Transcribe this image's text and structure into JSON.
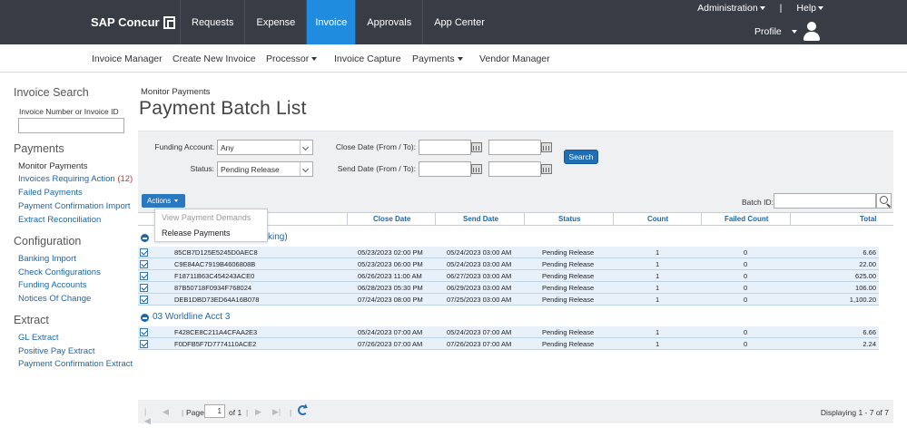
{
  "header": {
    "logo": "SAP Concur",
    "tabs": [
      "Requests",
      "Expense",
      "Invoice",
      "Approvals",
      "App Center"
    ],
    "active_tab": "Invoice",
    "administration": "Administration",
    "separator": "|",
    "help": "Help",
    "profile": "Profile"
  },
  "subnav": {
    "items": [
      "Invoice Manager",
      "Create New Invoice",
      "Processor",
      "Invoice Capture",
      "Payments",
      "Vendor Manager"
    ]
  },
  "sidebar": {
    "invoice_search_title": "Invoice Search",
    "invoice_number_label": "Invoice Number or Invoice ID",
    "payments_title": "Payments",
    "payments_items": [
      "Monitor Payments",
      "Invoices Requiring Action",
      "Failed Payments",
      "Payment Confirmation Import",
      "Extract Reconciliation"
    ],
    "requiring_action_count": "(12)",
    "configuration_title": "Configuration",
    "configuration_items": [
      "Banking Import",
      "Check Configurations",
      "Funding Accounts",
      "Notices Of Change"
    ],
    "extract_title": "Extract",
    "extract_items": [
      "GL Extract",
      "Positive Pay Extract",
      "Payment Confirmation Extract"
    ]
  },
  "main": {
    "breadcrumb": "Monitor Payments",
    "title": "Payment Batch List",
    "filters": {
      "funding_account_label": "Funding Account:",
      "funding_account_value": "Any",
      "status_label": "Status:",
      "status_value": "Pending Release",
      "close_date_label": "Close Date (From / To):",
      "send_date_label": "Send Date (From / To):",
      "search_button": "Search"
    },
    "toolbar": {
      "actions_button": "Actions",
      "batch_id_label": "Batch ID:"
    },
    "actions_menu": [
      "View Payment Demands",
      "Release Payments"
    ],
    "columns": [
      "Close Date",
      "Send Date",
      "Status",
      "Count",
      "Failed Count",
      "Total"
    ],
    "groups": [
      {
        "name_visible": "cking)",
        "rows": [
          {
            "id": "85CB7D125E5245D0AEC8",
            "close": "05/23/2023 02:00 PM",
            "send": "05/24/2023 03:00 AM",
            "status": "Pending Release",
            "count": "1",
            "failed": "0",
            "total": "6.66"
          },
          {
            "id": "C9E84AC7919B4606808B",
            "close": "05/23/2023 06:00 PM",
            "send": "05/24/2023 03:00 AM",
            "status": "Pending Release",
            "count": "1",
            "failed": "0",
            "total": "22.00"
          },
          {
            "id": "F18711B63C454243ACE0",
            "close": "06/26/2023 11:00 AM",
            "send": "06/27/2023 03:00 AM",
            "status": "Pending Release",
            "count": "1",
            "failed": "0",
            "total": "625.00"
          },
          {
            "id": "87B50718F0934F768024",
            "close": "06/28/2023 05:30 PM",
            "send": "06/29/2023 03:00 AM",
            "status": "Pending Release",
            "count": "1",
            "failed": "0",
            "total": "106.00"
          },
          {
            "id": "DEB1DBD73ED64A16B078",
            "close": "07/24/2023 08:00 PM",
            "send": "07/25/2023 03:00 AM",
            "status": "Pending Release",
            "count": "1",
            "failed": "0",
            "total": "1,100.20"
          }
        ]
      },
      {
        "name_visible": "03 Worldline Acct 3",
        "rows": [
          {
            "id": "F428CE8C211A4CFAA2E3",
            "close": "05/24/2023 07:00 AM",
            "send": "05/24/2023 07:00 AM",
            "status": "Pending Release",
            "count": "1",
            "failed": "0",
            "total": "6.66"
          },
          {
            "id": "F0DFB5F7D7774110ACE2",
            "close": "07/26/2023 07:00 AM",
            "send": "07/26/2023 07:00 AM",
            "status": "Pending Release",
            "count": "1",
            "failed": "0",
            "total": "2.24"
          }
        ]
      }
    ],
    "pager": {
      "page_label": "Page",
      "page_value": "1",
      "of_label": "of 1",
      "displaying": "Displaying 1 - 7 of 7"
    }
  }
}
